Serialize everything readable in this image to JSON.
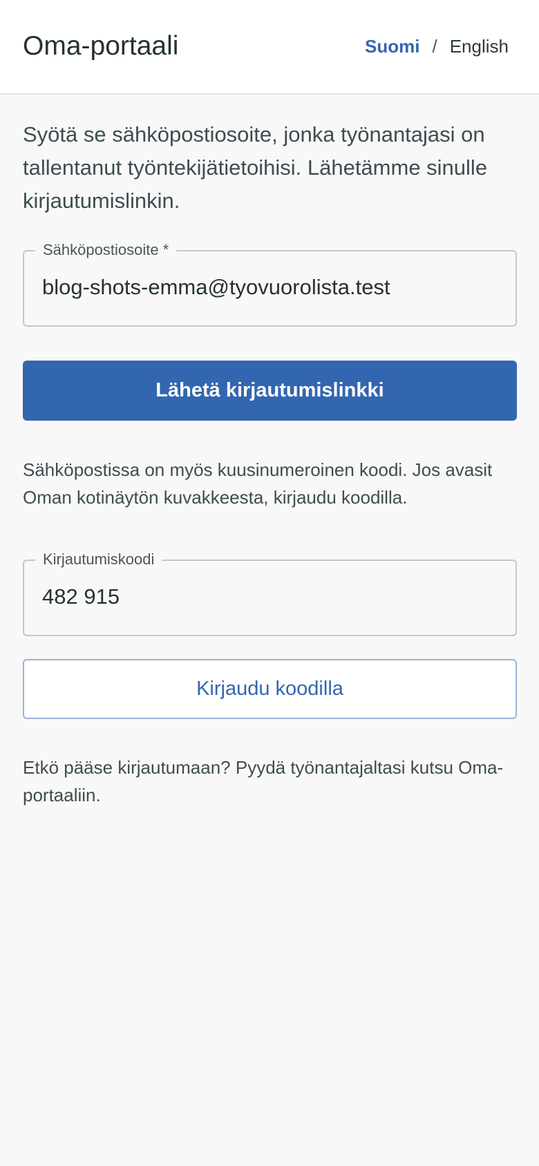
{
  "header": {
    "title": "Oma-portaali",
    "languages": {
      "active": "Suomi",
      "separator": "/",
      "other": "English"
    }
  },
  "intro_text": "Syötä se sähköpostiosoite, jonka työnantajasi on tallentanut työntekijätietoihisi. Lähetämme sinulle kirjautumislinkin.",
  "email_field": {
    "label": "Sähköpostiosoite *",
    "value": "blog-shots-emma@tyovuorolista.test"
  },
  "send_link_button": "Lähetä kirjautumislinkki",
  "code_info_text": "Sähköpostissa on myös kuusinumeroinen koodi. Jos avasit Oman kotinäytön kuvakkeesta, kirjaudu koodilla.",
  "code_field": {
    "label": "Kirjautumiskoodi",
    "value": "482 915"
  },
  "login_code_button": "Kirjaudu koodilla",
  "help_text": "Etkö pääse kirjautumaan? Pyydä työnantajaltasi kutsu Oma-portaaliin.",
  "colors": {
    "primary": "#3366b0",
    "text": "#2b3a3c",
    "background": "#f8f8f8"
  }
}
